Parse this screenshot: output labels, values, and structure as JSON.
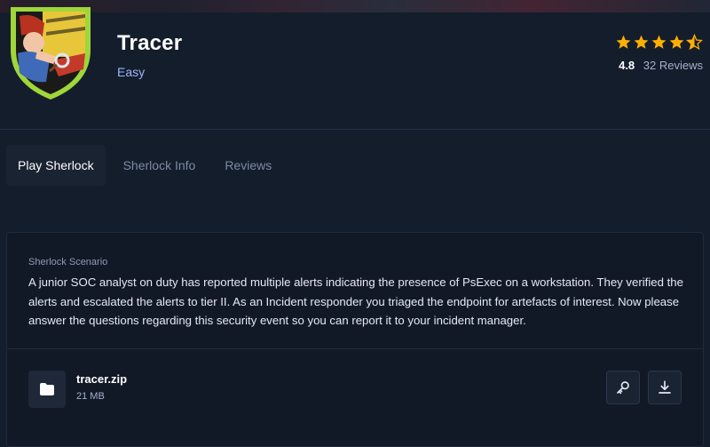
{
  "header": {
    "title": "Tracer",
    "difficulty": "Easy",
    "rating_value": "4.8",
    "reviews_count": "32 Reviews",
    "rating_stars": 4.5,
    "star_color": "#ffaf00",
    "difficulty_color": "#9fb3ff"
  },
  "tabs": [
    {
      "label": "Play Sherlock",
      "active": true
    },
    {
      "label": "Sherlock Info",
      "active": false
    },
    {
      "label": "Reviews",
      "active": false
    }
  ],
  "scenario": {
    "label": "Sherlock Scenario",
    "text": "A junior SOC analyst on duty has reported multiple alerts indicating the presence of PsExec on a workstation. They verified the alerts and escalated the alerts to tier II. As an Incident responder you triaged the endpoint for artefacts of interest. Now please answer the questions regarding this security event so you can report it to your incident manager."
  },
  "file": {
    "name": "tracer.zip",
    "size": "21 MB",
    "icon": "folder-icon",
    "actions": [
      "key-icon",
      "download-icon"
    ]
  },
  "colors": {
    "background": "#141d2b",
    "card": "#111927",
    "active_tab": "#1a2332"
  }
}
